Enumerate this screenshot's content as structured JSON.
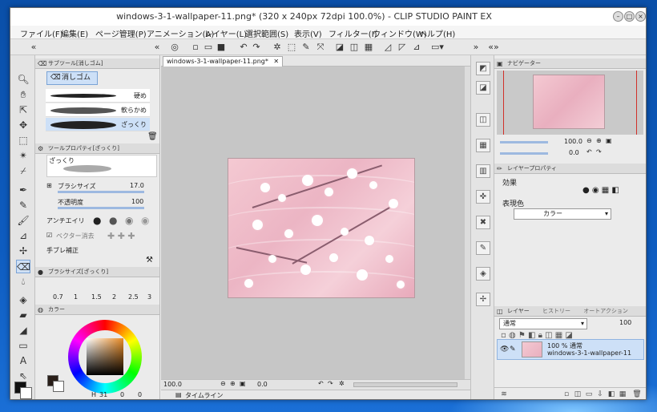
{
  "window": {
    "title": "windows-3-1-wallpaper-11.png* (320 x 240px 72dpi 100.0%) - CLIP STUDIO PAINT EX",
    "btn_min": "–",
    "btn_max": "□",
    "btn_close": "×"
  },
  "menu": [
    "ファイル(F)",
    "編集(E)",
    "ページ管理(P)",
    "アニメーション(A)",
    "レイヤー(L)",
    "選択範囲(S)",
    "表示(V)",
    "フィルター(I)",
    "ウィンドウ(W)",
    "ヘルプ(H)"
  ],
  "sub_tool": {
    "tab_label": "サブツール[消しゴム]",
    "group_label": "消しゴム",
    "brushes": [
      "硬め",
      "軟らかめ",
      "ざっくり"
    ],
    "selected_brush": "ざっくり"
  },
  "tool_property": {
    "tab_label": "ツールプロパティ[ざっくり]",
    "preview_label": "ざっくり",
    "brush_size_label": "ブラシサイズ",
    "brush_size_value": "17.0",
    "opacity_label": "不透明度",
    "opacity_value": "100",
    "antialias_label": "アンチエイリ",
    "vector_erase_label": "ベクター消去",
    "stabilize_label": "手ブレ補正"
  },
  "brush_size_panel": {
    "tab_label": "ブラシサイズ[ざっくり]",
    "sizes": [
      "0.7",
      "1",
      "1.5",
      "2",
      "2.5",
      "3"
    ]
  },
  "color_panel": {
    "tab_label": "カラー",
    "hex_main": "#2a1f1a",
    "hex_sub": "#ffffff",
    "h_value": "31",
    "s_value": "0",
    "v_value": "0"
  },
  "document": {
    "tab_label": "windows-3-1-wallpaper-11.png*",
    "zoom": "100.0",
    "angle": "0.0",
    "timeline_label": "タイムライン"
  },
  "navigator": {
    "tab_label": "ナビゲーター",
    "zoom_value": "100.0",
    "angle_value": "0.0"
  },
  "layer_property": {
    "tab_label": "レイヤープロパティ",
    "effect_label": "効果",
    "expression_label": "表現色",
    "expression_value": "カラー"
  },
  "layers_panel": {
    "tab_label": "レイヤー",
    "history_label": "ヒストリー",
    "auto_action_label": "オートアクション",
    "blend_mode": "通常",
    "opacity": "100",
    "layer_mode_text": "100 % 通常",
    "layer_name": "windows-3-1-wallpaper-11"
  }
}
